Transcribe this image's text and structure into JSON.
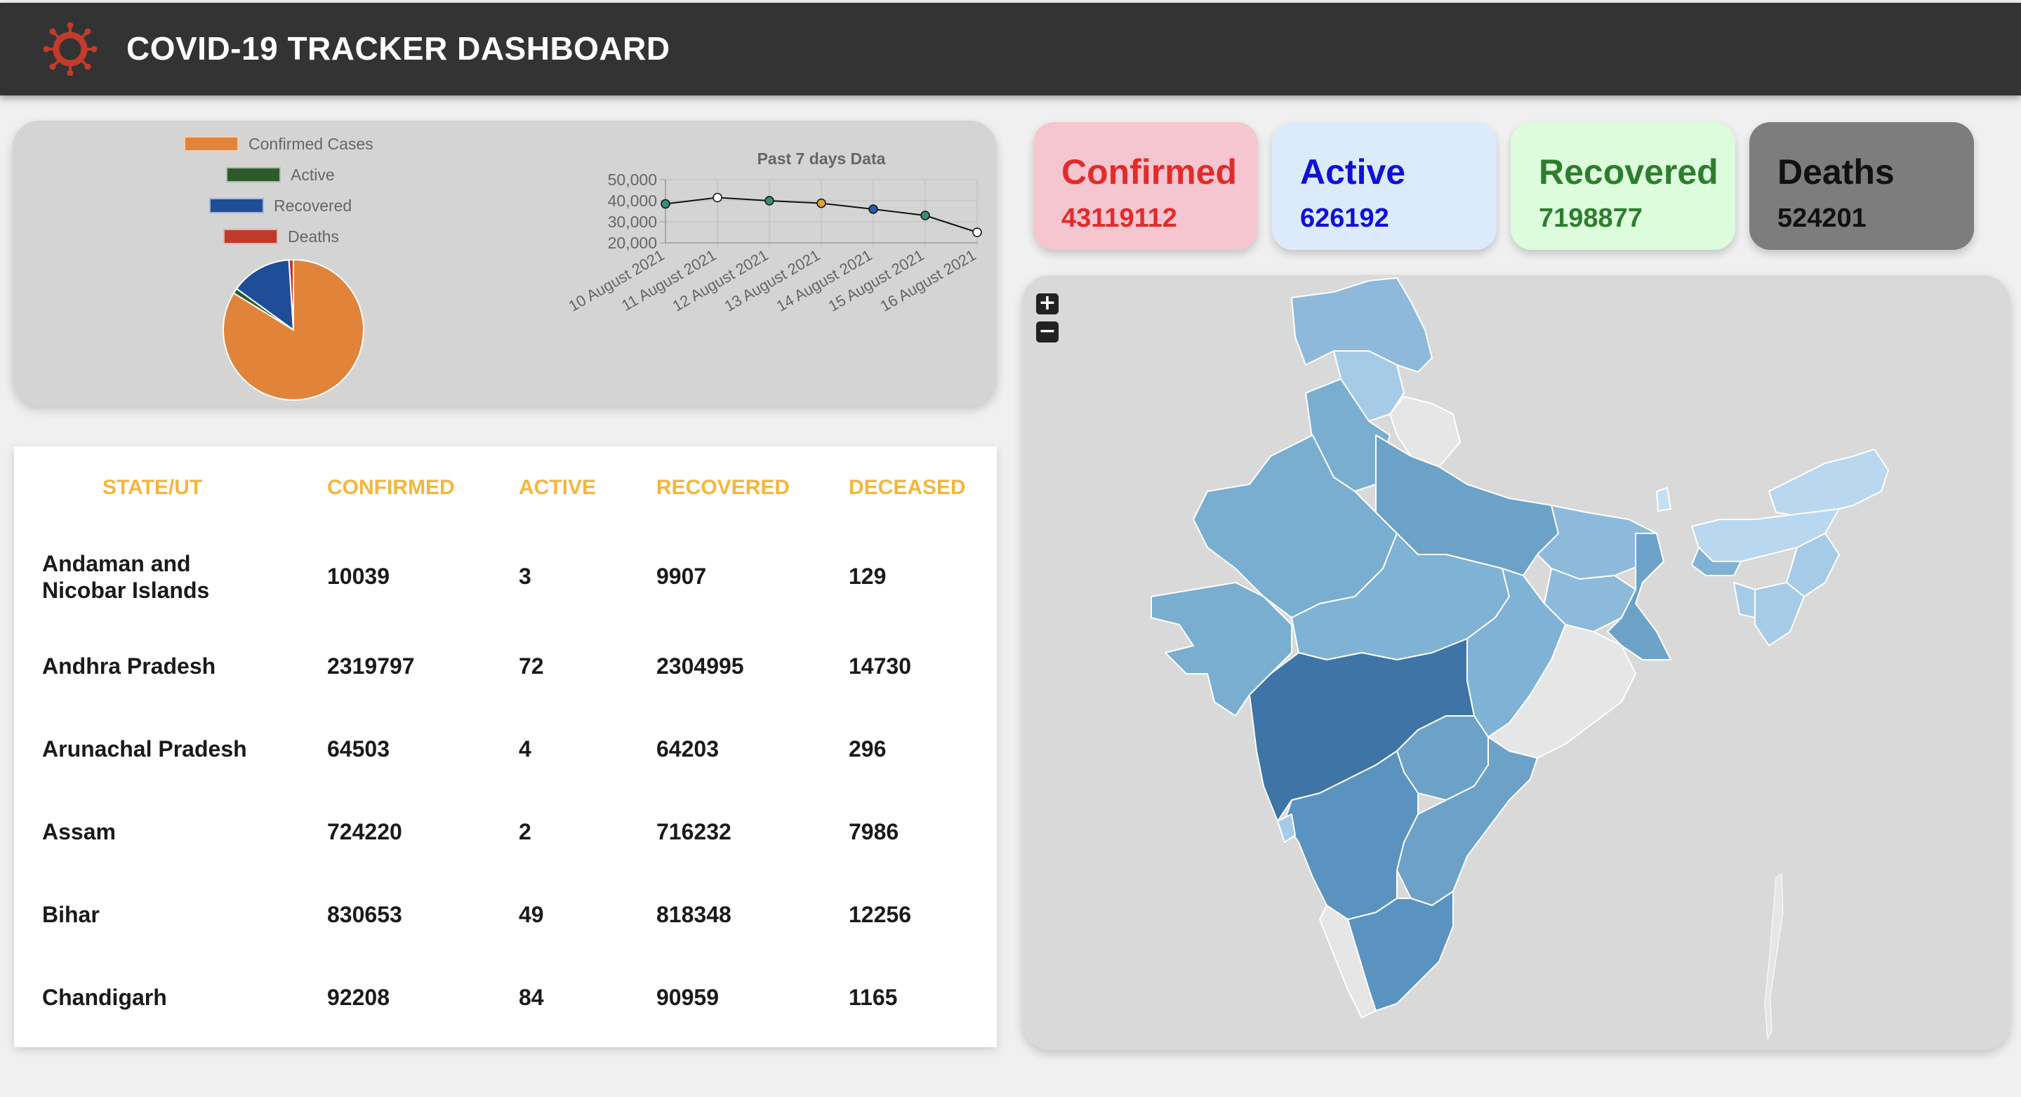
{
  "header": {
    "title": "COVID-19 TRACKER DASHBOARD",
    "logo_icon": "virus-icon"
  },
  "colors": {
    "confirmed": "#e1843a",
    "active": "#2d5a2b",
    "recovered": "#1f4d97",
    "deaths": "#c03a2b",
    "table_header": "#f4b63d"
  },
  "pie": {
    "legend": [
      "Confirmed Cases",
      "Active",
      "Recovered",
      "Deaths"
    ]
  },
  "chart_data": [
    {
      "type": "pie",
      "categories": [
        "Confirmed Cases",
        "Active",
        "Recovered",
        "Deaths"
      ],
      "values": [
        43119112,
        626192,
        7198877,
        524201
      ],
      "legend_position": "top"
    },
    {
      "type": "line",
      "title": "Past 7 days Data",
      "x": [
        "10 August 2021",
        "11 August 2021",
        "12 August 2021",
        "13 August 2021",
        "14 August 2021",
        "15 August 2021",
        "16 August 2021"
      ],
      "values": [
        38500,
        41500,
        40000,
        38800,
        36000,
        33000,
        25000
      ],
      "point_colors": [
        "#3a8c7a",
        "#ffffff",
        "#3a8c7a",
        "#e1a030",
        "#2a5aa0",
        "#3a8c7a",
        "#ffffff"
      ],
      "yticks": [
        "50,000",
        "40,000",
        "30,000",
        "20,000"
      ],
      "ylim": [
        20000,
        50000
      ],
      "grid": true
    }
  ],
  "table": {
    "headers": [
      "STATE/UT",
      "CONFIRMED",
      "ACTIVE",
      "RECOVERED",
      "DECEASED"
    ],
    "rows": [
      [
        "Andaman and Nicobar Islands",
        "10039",
        "3",
        "9907",
        "129"
      ],
      [
        "Andhra Pradesh",
        "2319797",
        "72",
        "2304995",
        "14730"
      ],
      [
        "Arunachal Pradesh",
        "64503",
        "4",
        "64203",
        "296"
      ],
      [
        "Assam",
        "724220",
        "2",
        "716232",
        "7986"
      ],
      [
        "Bihar",
        "830653",
        "49",
        "818348",
        "12256"
      ],
      [
        "Chandigarh",
        "92208",
        "84",
        "90959",
        "1165"
      ]
    ]
  },
  "cards": [
    {
      "title": "Confirmed",
      "value": "43119112",
      "bg": "#f5c6cf",
      "color": "#e22b2b"
    },
    {
      "title": "Active",
      "value": "626192",
      "bg": "#dcebfb",
      "color": "#1010d8"
    },
    {
      "title": "Recovered",
      "value": "7198877",
      "bg": "#dcfcdc",
      "color": "#2e7d2e"
    },
    {
      "title": "Deaths",
      "value": "524201",
      "bg": "#7d7d7d",
      "color": "#111111"
    }
  ],
  "map": {
    "zoom_in": "+",
    "zoom_out": "−"
  }
}
